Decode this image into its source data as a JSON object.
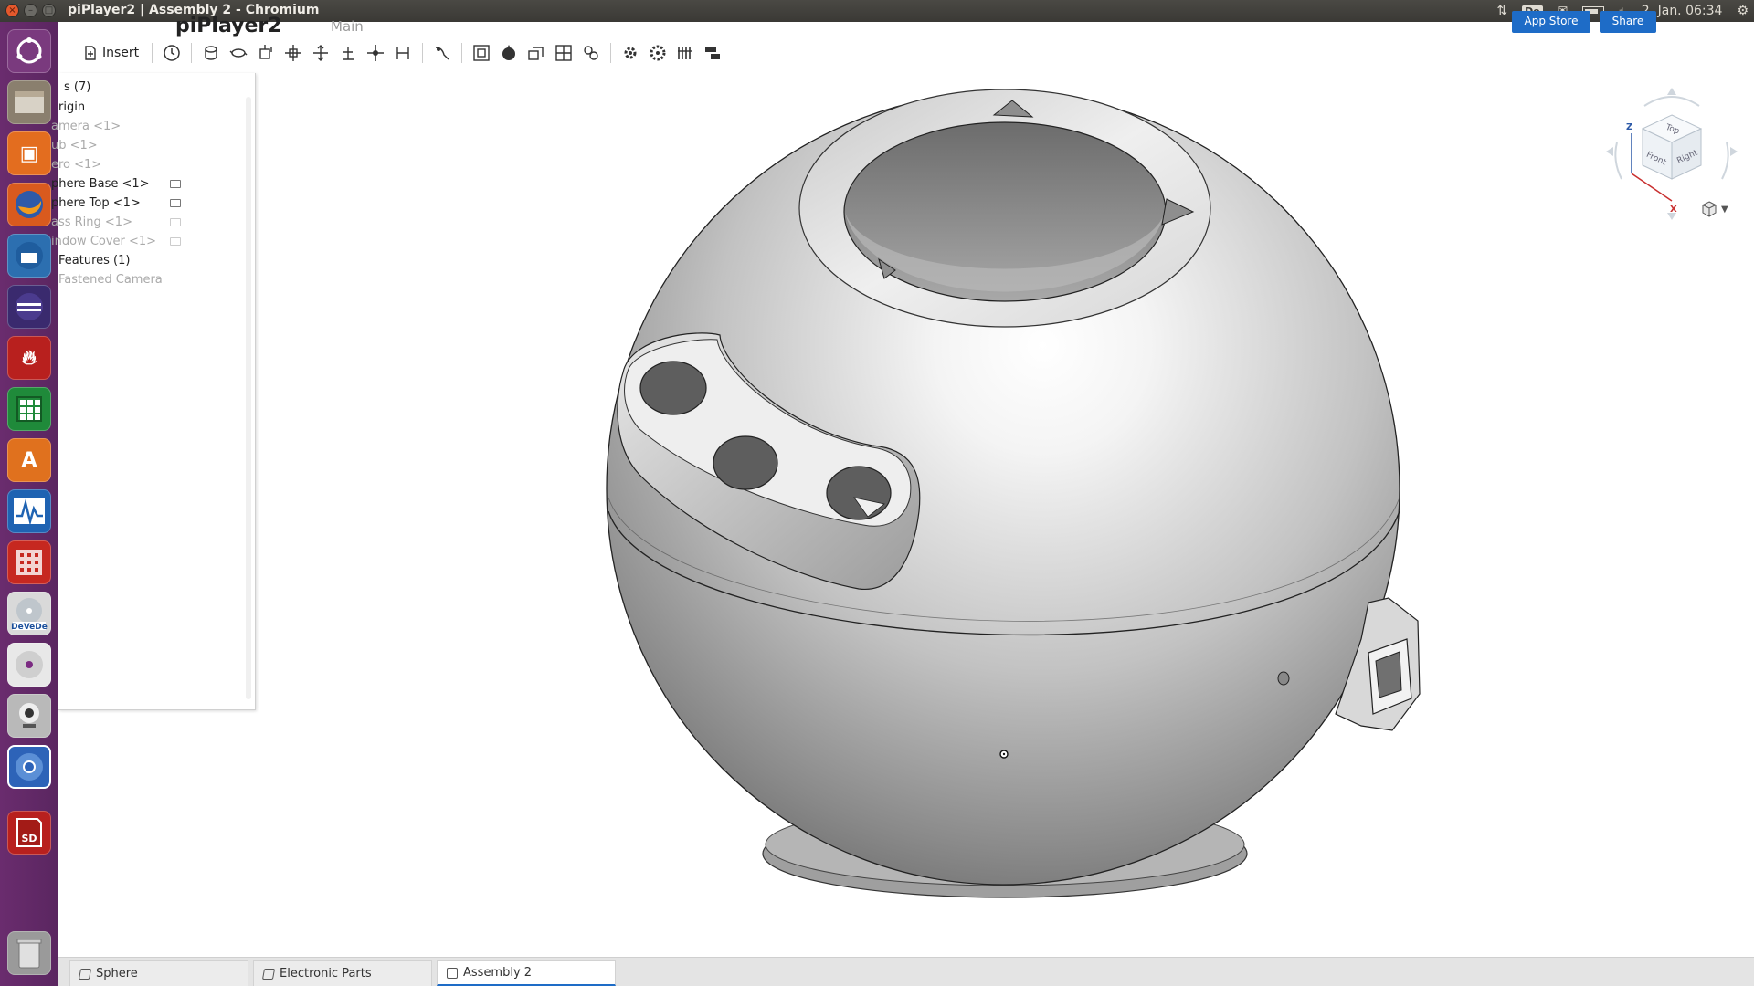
{
  "window": {
    "title": "piPlayer2 | Assembly 2 - Chromium"
  },
  "system_panel": {
    "keyboard_layout": "De",
    "datetime": "2. Jan. 06:34",
    "indicators": [
      "network-icon",
      "keyboard-icon",
      "mail-icon",
      "battery-icon",
      "volume-icon",
      "gear-icon"
    ]
  },
  "document": {
    "name": "piPlayer2",
    "branch": "Main",
    "app_store_label": "App Store",
    "share_label": "Share"
  },
  "toolbar": {
    "insert_label": "Insert"
  },
  "features": {
    "items": [
      {
        "label": "s (7)",
        "dim": false,
        "icon": false
      },
      {
        "label": "rigin",
        "dim": false,
        "icon": false
      },
      {
        "label": "amera <1>",
        "dim": true,
        "icon": false
      },
      {
        "label": "ub <1>",
        "dim": true,
        "icon": false
      },
      {
        "label": "ero <1>",
        "dim": true,
        "icon": false
      },
      {
        "label": "phere Base <1>",
        "dim": false,
        "icon": true
      },
      {
        "label": "phere Top <1>",
        "dim": false,
        "icon": true
      },
      {
        "label": "ass Ring <1>",
        "dim": true,
        "icon": true
      },
      {
        "label": "indow Cover <1>",
        "dim": true,
        "icon": true
      },
      {
        "label": "Features (1)",
        "dim": false,
        "icon": false
      },
      {
        "label": "Fastened Camera",
        "dim": true,
        "icon": false
      }
    ]
  },
  "viewcube": {
    "faces": {
      "top": "Top",
      "front": "Front",
      "right": "Right"
    },
    "axes": {
      "z": "Z",
      "x": "X"
    }
  },
  "tabs": [
    {
      "label": "Sphere",
      "active": false
    },
    {
      "label": "Electronic Parts",
      "active": false
    },
    {
      "label": "Assembly 2",
      "active": true
    }
  ],
  "colors": {
    "launcher": "#5a2660",
    "accent_blue": "#1e6cc7",
    "titlebar": "#3a3935"
  }
}
